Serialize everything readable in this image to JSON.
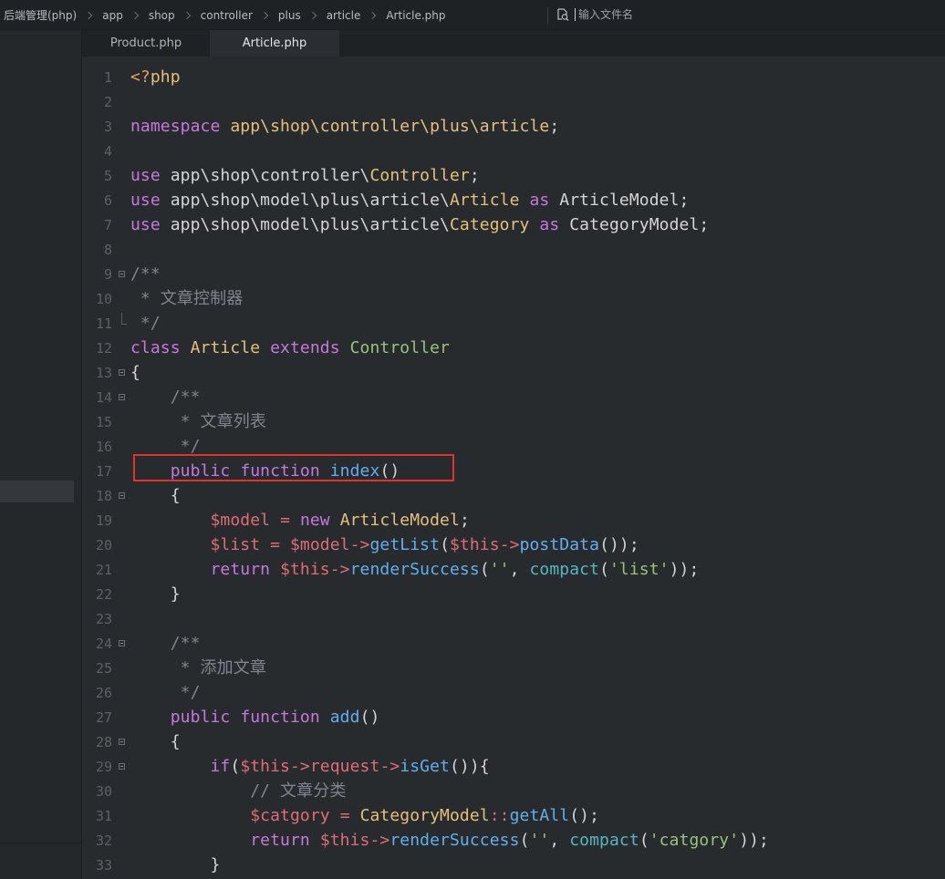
{
  "breadcrumb": [
    {
      "label": "后端管理(php)"
    },
    {
      "label": "app"
    },
    {
      "label": "shop"
    },
    {
      "label": "controller"
    },
    {
      "label": "plus"
    },
    {
      "label": "article"
    },
    {
      "label": "Article.php"
    }
  ],
  "search": {
    "placeholder": "输入文件名",
    "icon": "search-file-icon"
  },
  "tabs": [
    {
      "label": "Product.php",
      "active": false
    },
    {
      "label": "Article.php",
      "active": true
    }
  ],
  "colors": {
    "keyword": "#c678dd",
    "class": "#e5c07b",
    "variable": "#e06c75",
    "function": "#61afef",
    "string": "#98c379",
    "comment": "#7f848e",
    "builtin": "#56b6c2",
    "highlight": "#e0322f"
  },
  "highlight": {
    "line": 17
  },
  "lines": [
    {
      "n": "1",
      "fold": "",
      "tokens": [
        {
          "t": "<?",
          "k": "tag"
        },
        {
          "t": "php",
          "k": "tagword"
        }
      ]
    },
    {
      "n": "2",
      "fold": "",
      "tokens": []
    },
    {
      "n": "3",
      "fold": "",
      "tokens": [
        {
          "t": "namespace",
          "k": "keyword"
        },
        {
          "t": " ",
          "k": "default"
        },
        {
          "t": "app\\shop\\controller\\plus\\article",
          "k": "class"
        },
        {
          "t": ";",
          "k": "default"
        }
      ]
    },
    {
      "n": "4",
      "fold": "",
      "tokens": []
    },
    {
      "n": "5",
      "fold": "",
      "tokens": [
        {
          "t": "use",
          "k": "keyword"
        },
        {
          "t": " app\\shop\\controller\\",
          "k": "default"
        },
        {
          "t": "Controller",
          "k": "class"
        },
        {
          "t": ";",
          "k": "default"
        }
      ]
    },
    {
      "n": "6",
      "fold": "",
      "tokens": [
        {
          "t": "use",
          "k": "keyword"
        },
        {
          "t": " app\\shop\\model\\plus\\article\\",
          "k": "default"
        },
        {
          "t": "Article",
          "k": "class"
        },
        {
          "t": " ",
          "k": "default"
        },
        {
          "t": "as",
          "k": "keyword"
        },
        {
          "t": " ArticleModel;",
          "k": "default"
        }
      ]
    },
    {
      "n": "7",
      "fold": "",
      "tokens": [
        {
          "t": "use",
          "k": "keyword"
        },
        {
          "t": " app\\shop\\model\\plus\\article\\",
          "k": "default"
        },
        {
          "t": "Category",
          "k": "class"
        },
        {
          "t": " ",
          "k": "default"
        },
        {
          "t": "as",
          "k": "keyword"
        },
        {
          "t": " CategoryModel;",
          "k": "default"
        }
      ]
    },
    {
      "n": "8",
      "fold": "",
      "tokens": []
    },
    {
      "n": "9",
      "fold": "open",
      "tokens": [
        {
          "t": "/**",
          "k": "comment"
        }
      ]
    },
    {
      "n": "10",
      "fold": "",
      "tokens": [
        {
          "t": " * 文章控制器",
          "k": "comment"
        }
      ]
    },
    {
      "n": "11",
      "fold": "end",
      "tokens": [
        {
          "t": " */",
          "k": "comment"
        }
      ]
    },
    {
      "n": "12",
      "fold": "",
      "tokens": [
        {
          "t": "class",
          "k": "keyword"
        },
        {
          "t": " ",
          "k": "default"
        },
        {
          "t": "Article",
          "k": "class"
        },
        {
          "t": " ",
          "k": "default"
        },
        {
          "t": "extends",
          "k": "keyword"
        },
        {
          "t": " ",
          "k": "default"
        },
        {
          "t": "Controller",
          "k": "string"
        }
      ]
    },
    {
      "n": "13",
      "fold": "open",
      "tokens": [
        {
          "t": "{",
          "k": "default"
        }
      ]
    },
    {
      "n": "14",
      "fold": "open",
      "tokens": [
        {
          "t": "    /**",
          "k": "comment"
        }
      ]
    },
    {
      "n": "15",
      "fold": "",
      "tokens": [
        {
          "t": "     * 文章列表",
          "k": "comment"
        }
      ]
    },
    {
      "n": "16",
      "fold": "",
      "tokens": [
        {
          "t": "     */",
          "k": "comment"
        }
      ]
    },
    {
      "n": "17",
      "fold": "",
      "tokens": [
        {
          "t": "    ",
          "k": "default"
        },
        {
          "t": "public",
          "k": "keyword"
        },
        {
          "t": " ",
          "k": "default"
        },
        {
          "t": "function",
          "k": "keyword"
        },
        {
          "t": " ",
          "k": "default"
        },
        {
          "t": "index",
          "k": "function"
        },
        {
          "t": "()",
          "k": "default"
        }
      ]
    },
    {
      "n": "18",
      "fold": "open",
      "tokens": [
        {
          "t": "    {",
          "k": "default"
        }
      ]
    },
    {
      "n": "19",
      "fold": "",
      "tokens": [
        {
          "t": "        ",
          "k": "default"
        },
        {
          "t": "$model",
          "k": "variable"
        },
        {
          "t": " ",
          "k": "default"
        },
        {
          "t": "=",
          "k": "variable"
        },
        {
          "t": " ",
          "k": "default"
        },
        {
          "t": "new",
          "k": "keyword"
        },
        {
          "t": " ",
          "k": "default"
        },
        {
          "t": "ArticleModel",
          "k": "class"
        },
        {
          "t": ";",
          "k": "default"
        }
      ]
    },
    {
      "n": "20",
      "fold": "",
      "tokens": [
        {
          "t": "        ",
          "k": "default"
        },
        {
          "t": "$list",
          "k": "variable"
        },
        {
          "t": " ",
          "k": "default"
        },
        {
          "t": "=",
          "k": "variable"
        },
        {
          "t": " ",
          "k": "default"
        },
        {
          "t": "$model",
          "k": "variable"
        },
        {
          "t": "->",
          "k": "variable"
        },
        {
          "t": "getList",
          "k": "function"
        },
        {
          "t": "(",
          "k": "default"
        },
        {
          "t": "$this",
          "k": "variable"
        },
        {
          "t": "->",
          "k": "variable"
        },
        {
          "t": "postData",
          "k": "function"
        },
        {
          "t": "());",
          "k": "default"
        }
      ]
    },
    {
      "n": "21",
      "fold": "",
      "tokens": [
        {
          "t": "        ",
          "k": "default"
        },
        {
          "t": "return",
          "k": "keyword"
        },
        {
          "t": " ",
          "k": "default"
        },
        {
          "t": "$this",
          "k": "variable"
        },
        {
          "t": "->",
          "k": "variable"
        },
        {
          "t": "renderSuccess",
          "k": "function"
        },
        {
          "t": "(",
          "k": "default"
        },
        {
          "t": "''",
          "k": "string"
        },
        {
          "t": ", ",
          "k": "default"
        },
        {
          "t": "compact",
          "k": "builtin"
        },
        {
          "t": "(",
          "k": "default"
        },
        {
          "t": "'list'",
          "k": "string"
        },
        {
          "t": "));",
          "k": "default"
        }
      ]
    },
    {
      "n": "22",
      "fold": "",
      "tokens": [
        {
          "t": "    }",
          "k": "default"
        }
      ]
    },
    {
      "n": "23",
      "fold": "",
      "tokens": []
    },
    {
      "n": "24",
      "fold": "open",
      "tokens": [
        {
          "t": "    /**",
          "k": "comment"
        }
      ]
    },
    {
      "n": "25",
      "fold": "",
      "tokens": [
        {
          "t": "     * 添加文章",
          "k": "comment"
        }
      ]
    },
    {
      "n": "26",
      "fold": "",
      "tokens": [
        {
          "t": "     */",
          "k": "comment"
        }
      ]
    },
    {
      "n": "27",
      "fold": "",
      "tokens": [
        {
          "t": "    ",
          "k": "default"
        },
        {
          "t": "public",
          "k": "keyword"
        },
        {
          "t": " ",
          "k": "default"
        },
        {
          "t": "function",
          "k": "keyword"
        },
        {
          "t": " ",
          "k": "default"
        },
        {
          "t": "add",
          "k": "function"
        },
        {
          "t": "()",
          "k": "default"
        }
      ]
    },
    {
      "n": "28",
      "fold": "open",
      "tokens": [
        {
          "t": "    {",
          "k": "default"
        }
      ]
    },
    {
      "n": "29",
      "fold": "open",
      "tokens": [
        {
          "t": "        ",
          "k": "default"
        },
        {
          "t": "if",
          "k": "keyword"
        },
        {
          "t": "(",
          "k": "default"
        },
        {
          "t": "$this",
          "k": "variable"
        },
        {
          "t": "->",
          "k": "variable"
        },
        {
          "t": "request",
          "k": "variable"
        },
        {
          "t": "->",
          "k": "variable"
        },
        {
          "t": "isGet",
          "k": "function"
        },
        {
          "t": "()){",
          "k": "default"
        }
      ]
    },
    {
      "n": "30",
      "fold": "",
      "tokens": [
        {
          "t": "            // 文章分类",
          "k": "comment"
        }
      ]
    },
    {
      "n": "31",
      "fold": "",
      "tokens": [
        {
          "t": "            ",
          "k": "default"
        },
        {
          "t": "$catgory",
          "k": "variable"
        },
        {
          "t": " ",
          "k": "default"
        },
        {
          "t": "=",
          "k": "variable"
        },
        {
          "t": " ",
          "k": "default"
        },
        {
          "t": "CategoryModel",
          "k": "class"
        },
        {
          "t": "::",
          "k": "variable"
        },
        {
          "t": "getAll",
          "k": "function"
        },
        {
          "t": "();",
          "k": "default"
        }
      ]
    },
    {
      "n": "32",
      "fold": "",
      "tokens": [
        {
          "t": "            ",
          "k": "default"
        },
        {
          "t": "return",
          "k": "keyword"
        },
        {
          "t": " ",
          "k": "default"
        },
        {
          "t": "$this",
          "k": "variable"
        },
        {
          "t": "->",
          "k": "variable"
        },
        {
          "t": "renderSuccess",
          "k": "function"
        },
        {
          "t": "(",
          "k": "default"
        },
        {
          "t": "''",
          "k": "string"
        },
        {
          "t": ", ",
          "k": "default"
        },
        {
          "t": "compact",
          "k": "builtin"
        },
        {
          "t": "(",
          "k": "default"
        },
        {
          "t": "'catgory'",
          "k": "string"
        },
        {
          "t": "));",
          "k": "default"
        }
      ]
    },
    {
      "n": "33",
      "fold": "",
      "tokens": [
        {
          "t": "        }",
          "k": "default"
        }
      ]
    }
  ]
}
